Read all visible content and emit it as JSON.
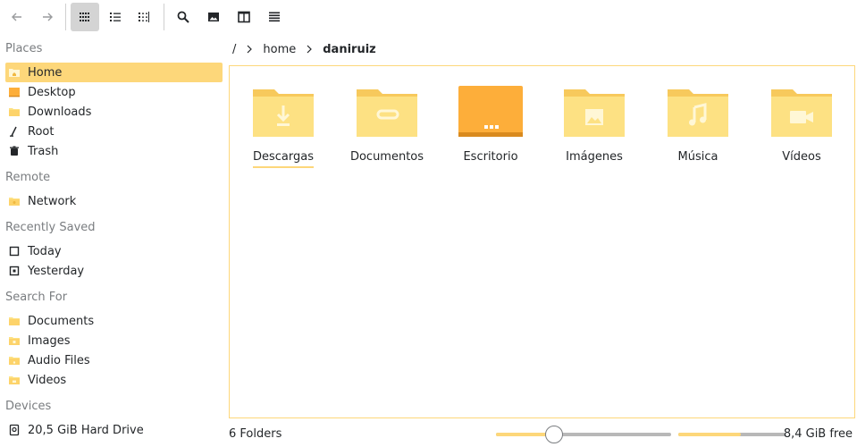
{
  "toolbar": {
    "back_icon": "arrow-left-icon",
    "forward_icon": "arrow-right-icon",
    "view_modes": [
      "icon-view-icon",
      "compact-view-icon",
      "details-view-icon"
    ],
    "actions": [
      "search-icon",
      "preview-icon",
      "split-view-icon",
      "menu-icon"
    ]
  },
  "sidebar": {
    "places": {
      "title": "Places",
      "items": [
        {
          "label": "Home",
          "icon": "home-folder-icon",
          "selected": true
        },
        {
          "label": "Desktop",
          "icon": "desktop-folder-icon"
        },
        {
          "label": "Downloads",
          "icon": "downloads-folder-icon"
        },
        {
          "label": "Root",
          "icon": "root-icon"
        },
        {
          "label": "Trash",
          "icon": "trash-icon"
        }
      ]
    },
    "remote": {
      "title": "Remote",
      "items": [
        {
          "label": "Network",
          "icon": "network-folder-icon"
        }
      ]
    },
    "recent": {
      "title": "Recently Saved",
      "items": [
        {
          "label": "Today",
          "icon": "calendar-today-icon"
        },
        {
          "label": "Yesterday",
          "icon": "calendar-yesterday-icon"
        }
      ]
    },
    "search": {
      "title": "Search For",
      "items": [
        {
          "label": "Documents",
          "icon": "documents-folder-icon"
        },
        {
          "label": "Images",
          "icon": "images-folder-icon"
        },
        {
          "label": "Audio Files",
          "icon": "audio-folder-icon"
        },
        {
          "label": "Videos",
          "icon": "videos-folder-icon"
        }
      ]
    },
    "devices": {
      "title": "Devices",
      "items": [
        {
          "label": "20,5 GiB Hard Drive",
          "icon": "hard-drive-icon"
        }
      ]
    }
  },
  "breadcrumb": {
    "root": "/",
    "parts": [
      "home",
      "daniruiz"
    ]
  },
  "folders": [
    {
      "name": "Descargas",
      "icon": "download-folder-icon"
    },
    {
      "name": "Documentos",
      "icon": "documents-folder-icon"
    },
    {
      "name": "Escritorio",
      "icon": "desktop-folder-icon"
    },
    {
      "name": "Imágenes",
      "icon": "pictures-folder-icon"
    },
    {
      "name": "Música",
      "icon": "music-folder-icon"
    },
    {
      "name": "Vídeos",
      "icon": "videos-folder-icon"
    }
  ],
  "status": {
    "summary": "6 Folders",
    "free": "8,4 GiB free",
    "zoom_fraction": 0.33,
    "used_fraction": 0.58
  },
  "colors": {
    "accent": "#fdd77a",
    "folder_body": "#fde183",
    "folder_back": "#f7c95c",
    "desktop_folder": "#fdae3a"
  }
}
